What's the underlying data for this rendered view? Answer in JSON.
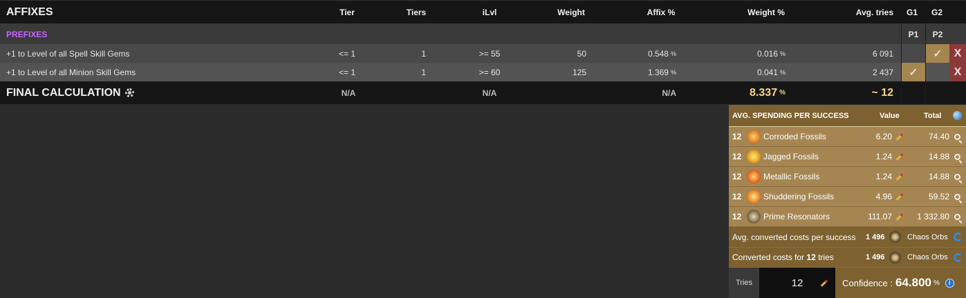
{
  "header": {
    "title": "AFFIXES",
    "cols": [
      "Tier",
      "Tiers",
      "iLvl",
      "Weight",
      "Affix %",
      "Weight %",
      "Avg. tries",
      "G1",
      "G2"
    ]
  },
  "prefixes": {
    "title": "PREFIXES",
    "g1": "P1",
    "g2": "P2"
  },
  "affixes": [
    {
      "name": "+1 to Level of all Spell Skill Gems",
      "tier": "<= 1",
      "tiers": "1",
      "ilvl": ">= 55",
      "weight": "50",
      "affix_pct": "0.548",
      "weight_pct": "0.016",
      "avg_tries": "6 091",
      "g1_checked": false,
      "g2_checked": true
    },
    {
      "name": "+1 to Level of all Minion Skill Gems",
      "tier": "<= 1",
      "tiers": "1",
      "ilvl": ">= 60",
      "weight": "125",
      "affix_pct": "1.369",
      "weight_pct": "0.041",
      "avg_tries": "2 437",
      "g1_checked": true,
      "g2_checked": false
    }
  ],
  "symbols": {
    "pct": "%",
    "check": "✓",
    "remove": "X"
  },
  "final": {
    "title": "FINAL CALCULATION",
    "tier": "N/A",
    "ilvl": "N/A",
    "affix_pct": "N/A",
    "weight_pct": "8.337",
    "avg_tries": "~ 12"
  },
  "spending": {
    "title": "AVG. SPENDING PER SUCCESS",
    "value_label": "Value",
    "total_label": "Total",
    "items": [
      {
        "qty": "12",
        "name": "Corroded Fossils",
        "value": "6.20",
        "total": "74.40",
        "icon": "corroded-fossil-icon",
        "color": "#d9822b"
      },
      {
        "qty": "12",
        "name": "Jagged Fossils",
        "value": "1.24",
        "total": "14.88",
        "icon": "jagged-fossil-icon",
        "color": "#e0a020"
      },
      {
        "qty": "12",
        "name": "Metallic Fossils",
        "value": "1.24",
        "total": "14.88",
        "icon": "metallic-fossil-icon",
        "color": "#e56b1f"
      },
      {
        "qty": "12",
        "name": "Shuddering Fossils",
        "value": "4.96",
        "total": "59.52",
        "icon": "shuddering-fossil-icon",
        "color": "#e8882a"
      },
      {
        "qty": "12",
        "name": "Prime Resonators",
        "value": "111.07",
        "total": "1 332.80",
        "icon": "prime-resonator-icon",
        "color": "#8a7450"
      }
    ],
    "avg_converted_label": "Avg. converted costs per success",
    "avg_converted_value": "1 496",
    "currency": "Chaos Orbs",
    "converted_for_prefix": "Converted costs for",
    "converted_for_tries": "12",
    "converted_for_suffix": "tries",
    "converted_value": "1 496",
    "tries_label": "Tries",
    "tries_value": "12",
    "confidence_label": "Confidence :",
    "confidence_value": "64.800"
  }
}
